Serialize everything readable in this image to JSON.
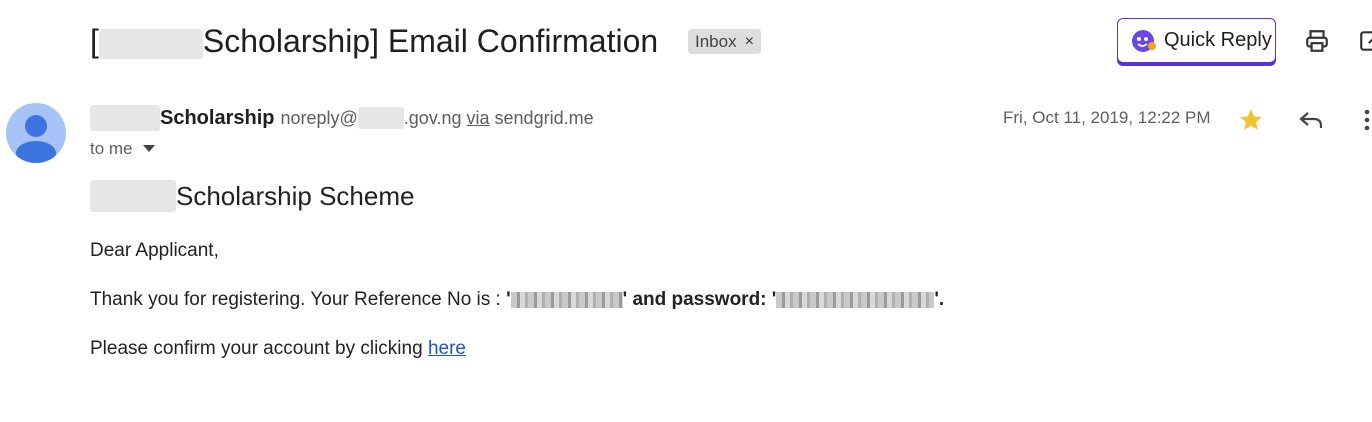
{
  "subject": {
    "open_bracket": "[",
    "title": "Scholarship] Email Confirmation",
    "label_badge": "Inbox",
    "remove_symbol": "×"
  },
  "toolbar": {
    "quick_reply_label": "Quick Reply",
    "print_icon": "print-icon",
    "open_new_window_icon": "open-in-new-window-icon"
  },
  "message": {
    "sender_name": "Scholarship",
    "sender_email_prefix": "noreply@",
    "sender_email_suffix": ".gov.ng",
    "via_label": "via",
    "via_domain": "sendgrid.me",
    "recipient_label": "to me",
    "date": "Fri, Oct 11, 2019, 12:22 PM",
    "star_color": "#f4c430"
  },
  "body": {
    "heading": "Scholarship Scheme",
    "greeting": "Dear Applicant,",
    "line1_prefix": "Thank you for registering. Your Reference No is : ",
    "quote_open": "'",
    "line1_mid": "' and password: '",
    "line1_end": "'.",
    "line2_prefix": "Please confirm your account by clicking ",
    "link_text": "here"
  },
  "colors": {
    "quick_reply_border": "#5a35d6",
    "link": "#1a56c9",
    "avatar_bg": "#a6c3f6",
    "avatar_fg": "#3d74e0"
  }
}
